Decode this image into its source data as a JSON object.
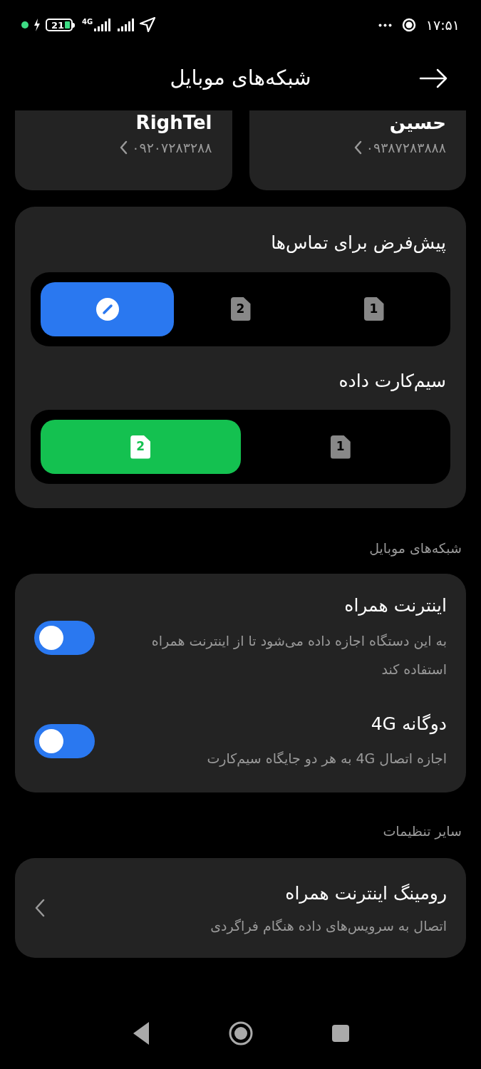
{
  "status_bar": {
    "battery": "21",
    "network": "4G",
    "time": "۱۷:۵۱"
  },
  "header": {
    "title": "شبکه‌های موبایل"
  },
  "sim_cards": [
    {
      "name": "حسین",
      "number": "۰۹۳۸۷۲۸۳۸۸۸"
    },
    {
      "name": "RighTel",
      "number": "۰۹۲۰۷۲۸۳۲۸۸"
    }
  ],
  "sim_preferences": [
    {
      "title": "پیش‌فرض برای تماس‌ها",
      "kind": "calls",
      "options": [
        {
          "kind": "sim",
          "label": "1",
          "selected": false
        },
        {
          "kind": "sim",
          "label": "2",
          "selected": false
        },
        {
          "kind": "ask",
          "selected": true
        }
      ]
    },
    {
      "title": "سیم‌کارت داده",
      "kind": "data",
      "options": [
        {
          "kind": "sim",
          "label": "1",
          "selected": false
        },
        {
          "kind": "sim",
          "label": "2",
          "selected": true
        }
      ]
    }
  ],
  "mobile_networks": {
    "heading": "شبکه‌های موبایل",
    "items": [
      {
        "title": "اینترنت همراه",
        "subtitle": "به این دستگاه اجازه داده می‌شود تا از اینترنت همراه استفاده کند",
        "on": true
      },
      {
        "title": "دوگانه 4G",
        "subtitle": "اجازه اتصال 4G به هر دو جایگاه سیم‌کارت",
        "on": true
      }
    ]
  },
  "other_settings": {
    "heading": "سایر تنظیمات",
    "items": [
      {
        "title": "رومینگ اینترنت همراه",
        "subtitle": "اتصال به سرویس‌های داده هنگام فراگردی"
      }
    ]
  }
}
